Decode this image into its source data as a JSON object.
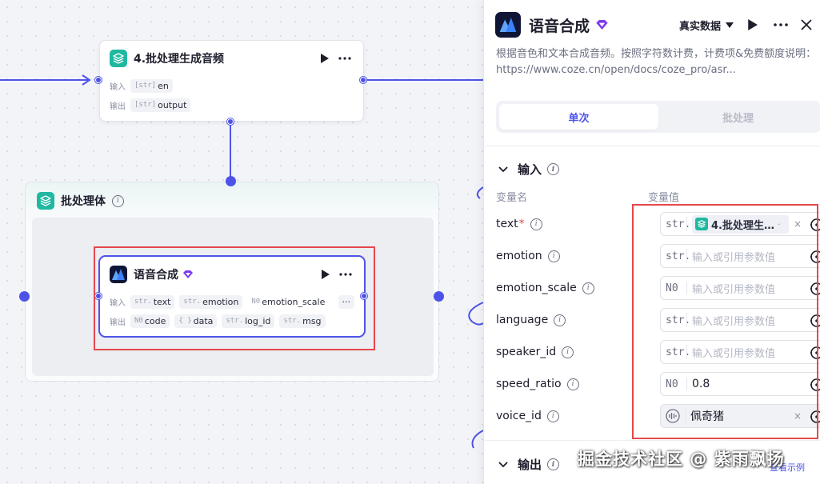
{
  "colors": {
    "accent": "#4d53e8",
    "teal_icon": "#1fb8a1",
    "highlight": "#e5484d"
  },
  "canvas": {
    "node_top": {
      "title": "4.批处理生成音频",
      "input_label": "输入",
      "output_label": "输出",
      "inputs": [
        {
          "type": "[str]",
          "name": "en"
        }
      ],
      "outputs": [
        {
          "type": "[str]",
          "name": "output"
        }
      ]
    },
    "batch": {
      "title": "批处理体"
    },
    "node_tts": {
      "title": "语音合成",
      "input_label": "输入",
      "output_label": "输出",
      "inputs": [
        {
          "type": "str.",
          "name": "text"
        },
        {
          "type": "str.",
          "name": "emotion"
        },
        {
          "type": "N0",
          "name": "emotion_scale"
        }
      ],
      "more_label": "···",
      "outputs": [
        {
          "type": "N0",
          "name": "code"
        },
        {
          "type": "{ }",
          "name": "data"
        },
        {
          "type": "str.",
          "name": "log_id"
        },
        {
          "type": "str.",
          "name": "msg"
        }
      ]
    }
  },
  "panel": {
    "title": "语音合成",
    "mode": "真实数据",
    "description": "根据音色和文本合成音频。按照字符数计费，计费项&免费额度说明：https://www.coze.cn/open/docs/coze_pro/asr...",
    "tabs": [
      {
        "label": "单次",
        "active": true
      },
      {
        "label": "批处理",
        "active": false
      }
    ],
    "input_section": "输入",
    "col_name": "变量名",
    "col_value": "变量值",
    "params": [
      {
        "name": "text",
        "required": true,
        "type": "str.",
        "ref": "4.批处理生…",
        "placeholder": "",
        "value": ""
      },
      {
        "name": "emotion",
        "required": false,
        "type": "str.",
        "placeholder": "输入或引用参数值",
        "value": ""
      },
      {
        "name": "emotion_scale",
        "required": false,
        "type": "N0",
        "placeholder": "输入或引用参数值",
        "value": ""
      },
      {
        "name": "language",
        "required": false,
        "type": "str.",
        "placeholder": "输入或引用参数值",
        "value": ""
      },
      {
        "name": "speaker_id",
        "required": false,
        "type": "str.",
        "placeholder": "输入或引用参数值",
        "value": ""
      },
      {
        "name": "speed_ratio",
        "required": false,
        "type": "N0",
        "placeholder": "",
        "value": "0.8"
      },
      {
        "name": "voice_id",
        "required": false,
        "type": "voice",
        "placeholder": "",
        "value": "佩奇猪"
      }
    ],
    "output_section": "输出",
    "example_link": "查看示例"
  },
  "watermark": "掘金技术社区 @ 紫雨飘扬"
}
